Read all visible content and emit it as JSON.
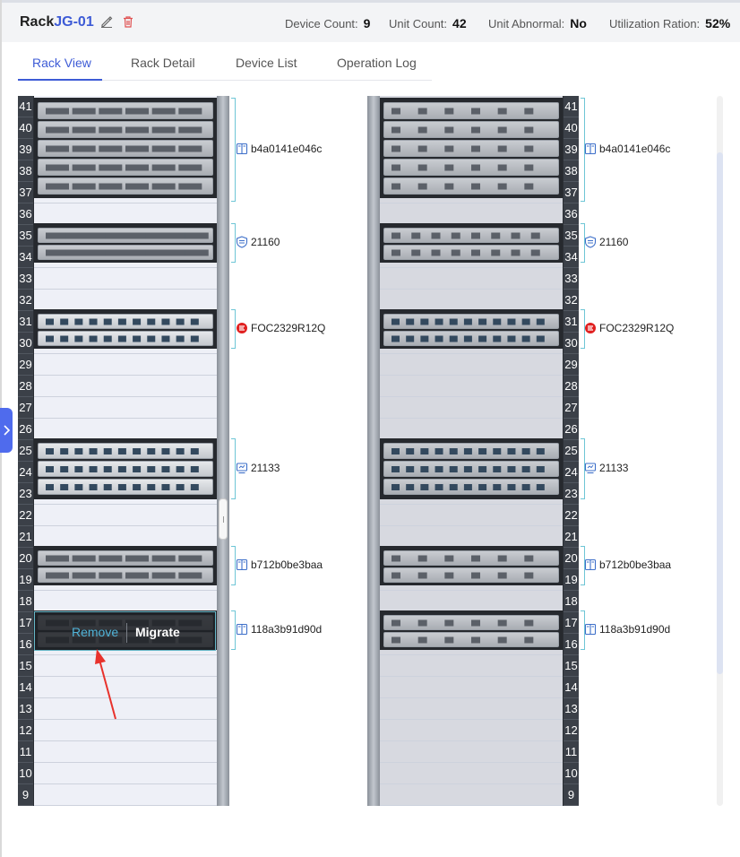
{
  "header": {
    "rack_prefix": "Rack",
    "rack_code": "JG-01",
    "stats": [
      {
        "label": "Device Count:",
        "value": "9"
      },
      {
        "label": "Unit Count:",
        "value": "42"
      },
      {
        "label": "Unit Abnormal:",
        "value": "No"
      },
      {
        "label": "Utilization Ration:",
        "value": "52%"
      }
    ]
  },
  "tabs": [
    {
      "label": "Rack View",
      "active": true
    },
    {
      "label": "Rack Detail",
      "active": false
    },
    {
      "label": "Device List",
      "active": false
    },
    {
      "label": "Operation Log",
      "active": false
    }
  ],
  "units": [
    "41",
    "40",
    "39",
    "38",
    "37",
    "36",
    "35",
    "34",
    "33",
    "32",
    "31",
    "30",
    "29",
    "28",
    "27",
    "26",
    "25",
    "24",
    "23",
    "22",
    "21",
    "20",
    "19",
    "18",
    "17",
    "16",
    "15",
    "14",
    "13",
    "12",
    "11",
    "10",
    "9"
  ],
  "devices": [
    {
      "id": "b4a0141e046c",
      "icon": "server-icon"
    },
    {
      "id": "21160",
      "icon": "shield-icon"
    },
    {
      "id": "FOC2329R12Q",
      "icon": "brand-logo-icon"
    },
    {
      "id": "21133",
      "icon": "monitor-icon"
    },
    {
      "id": "b712b0be3baa",
      "icon": "server-icon"
    },
    {
      "id": "118a3b91d90d",
      "icon": "server-icon"
    }
  ],
  "context_menu": {
    "remove": "Remove",
    "migrate": "Migrate"
  },
  "colors": {
    "accent": "#3d5bd6",
    "bracket": "#6ec6d6",
    "remove": "#4fb3d8",
    "arrow": "#e8322c"
  }
}
